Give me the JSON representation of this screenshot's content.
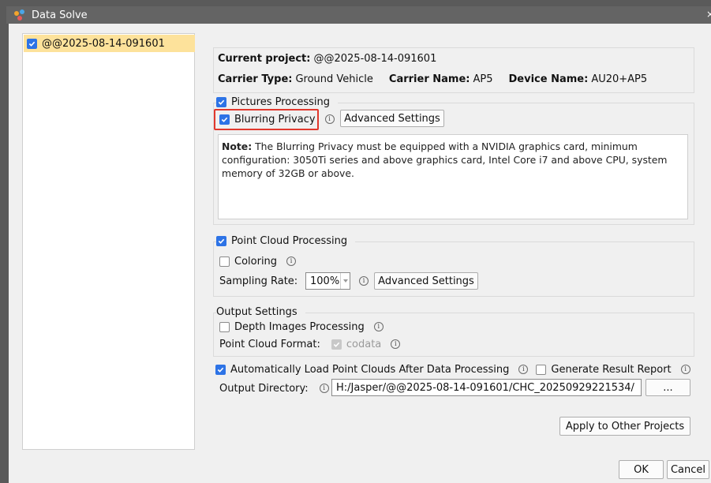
{
  "window": {
    "title": "Data Solve",
    "close_glyph": "×"
  },
  "project_list": {
    "items": [
      {
        "label": "@@2025-08-14-091601",
        "checked": true
      }
    ]
  },
  "project_info": {
    "current_project_label": "Current project:",
    "current_project_value": "@@2025-08-14-091601",
    "carrier_type_label": "Carrier Type:",
    "carrier_type_value": "Ground Vehicle",
    "carrier_name_label": "Carrier Name:",
    "carrier_name_value": "AP5",
    "device_name_label": "Device Name:",
    "device_name_value": "AU20+AP5"
  },
  "pictures_processing": {
    "label": "Pictures Processing",
    "checked": true,
    "blurring_privacy_label": "Blurring Privacy",
    "blurring_privacy_checked": true,
    "advanced_settings_label": "Advanced Settings",
    "note_label": "Note:",
    "note_text": " The Blurring Privacy must be equipped with a NVIDIA graphics card, minimum configuration: 3050Ti series and above graphics card, Intel Core i7 and above CPU, system memory of 32GB or above."
  },
  "point_cloud_processing": {
    "label": "Point Cloud Processing",
    "checked": true,
    "coloring_label": "Coloring",
    "coloring_checked": false,
    "sampling_rate_label": "Sampling Rate:",
    "sampling_rate_value": "100%",
    "advanced_settings_label": "Advanced Settings"
  },
  "output_settings": {
    "label": "Output Settings",
    "depth_images_label": "Depth Images Processing",
    "depth_images_checked": false,
    "point_cloud_format_label": "Point Cloud Format:",
    "point_cloud_format_value": "codata",
    "point_cloud_format_checked": true
  },
  "auto_load": {
    "label": "Automatically Load Point Clouds After Data Processing",
    "checked": true,
    "generate_report_label": "Generate Result Report",
    "generate_report_checked": false
  },
  "output_directory": {
    "label": "Output Directory:",
    "value": "H:/Jasper/@@2025-08-14-091601/CHC_20250929221534/",
    "browse_label": "..."
  },
  "buttons": {
    "apply_other_label": "Apply to Other Projects",
    "ok_label": "OK",
    "cancel_label": "Cancel"
  },
  "colors": {
    "accent": "#2d73e6",
    "selection": "#fde29b",
    "highlight": "#e1382d",
    "titlebar": "#646464"
  },
  "icons": [
    "app-logo-icon",
    "checkbox-icon",
    "info-icon",
    "dropdown-arrow-icon",
    "close-icon"
  ]
}
